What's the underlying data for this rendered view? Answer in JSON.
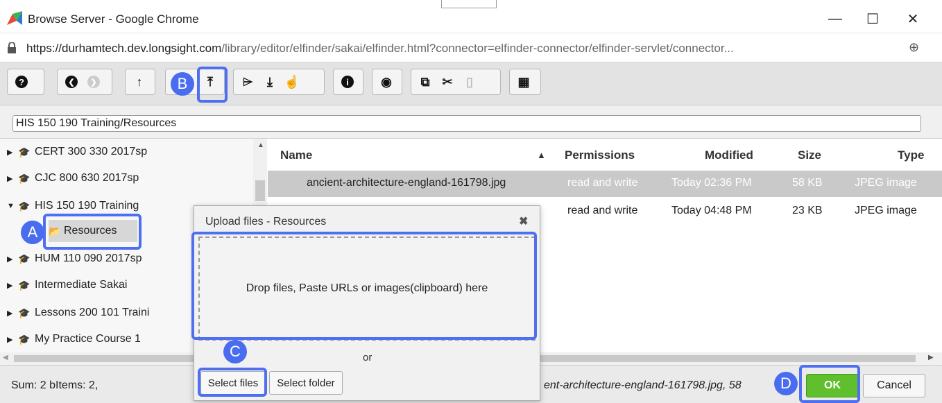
{
  "window": {
    "title": "Browse Server - Google Chrome",
    "minimize_glyph": "—",
    "maximize_glyph": "☐",
    "close_glyph": "✕"
  },
  "address": {
    "url_host": "https://durhamtech.dev.longsight.com",
    "url_path": "/library/editor/elfinder/sakai/elfinder.html?connector=elfinder-connector/elfinder-servlet/connector...",
    "zoom_glyph": "⊕"
  },
  "toolbar": {
    "groups": [
      {
        "buttons": [
          {
            "icon": "help-icon",
            "glyph": "?"
          }
        ]
      },
      {
        "buttons": [
          {
            "icon": "back-icon",
            "glyph": "❮"
          },
          {
            "icon": "forward-icon",
            "glyph": "❯",
            "disabled": true
          }
        ]
      },
      {
        "buttons": [
          {
            "icon": "up-icon",
            "glyph": "↑"
          }
        ]
      },
      {
        "buttons": [
          {
            "icon": "upload-icon",
            "glyph": "⤒"
          }
        ]
      },
      {
        "buttons": [
          {
            "icon": "open-folder-icon",
            "glyph": "⌲"
          },
          {
            "icon": "download-icon",
            "glyph": "⤓"
          },
          {
            "icon": "select-icon",
            "glyph": "☝"
          }
        ]
      },
      {
        "buttons": [
          {
            "icon": "info-icon",
            "glyph": "i"
          }
        ]
      },
      {
        "buttons": [
          {
            "icon": "preview-icon",
            "glyph": "◉"
          }
        ]
      },
      {
        "buttons": [
          {
            "icon": "copy-icon",
            "glyph": "⧉"
          },
          {
            "icon": "cut-icon",
            "glyph": "✂"
          },
          {
            "icon": "paste-icon",
            "glyph": "▯",
            "disabled": true
          }
        ]
      },
      {
        "buttons": [
          {
            "icon": "grid-view-icon",
            "glyph": "▦"
          }
        ]
      }
    ]
  },
  "path": {
    "value": "HIS 150 190 Training/Resources"
  },
  "tree": {
    "items": [
      {
        "label": "CERT 300 330 2017sp",
        "arrow": "▶"
      },
      {
        "label": "CJC 800 630 2017sp",
        "arrow": "▶"
      },
      {
        "label": "HIS 150 190 Training",
        "arrow": "▼"
      },
      {
        "label": "Resources",
        "active": true
      },
      {
        "label": "HUM 110 090 2017sp",
        "arrow": "▶"
      },
      {
        "label": "Intermediate Sakai",
        "arrow": "▶"
      },
      {
        "label": "Lessons 200 101 Traini",
        "arrow": "▶"
      },
      {
        "label": "My Practice Course 1",
        "arrow": "▶"
      }
    ]
  },
  "files": {
    "headers": {
      "name": "Name",
      "sort": "▲",
      "permissions": "Permissions",
      "modified": "Modified",
      "size": "Size",
      "type": "Type"
    },
    "rows": [
      {
        "name": "ancient-architecture-england-161798.jpg",
        "permissions": "read and write",
        "modified": "Today 02:36 PM",
        "size": "58 KB",
        "type": "JPEG image"
      },
      {
        "name": "",
        "permissions": "read and write",
        "modified": "Today 04:48 PM",
        "size": "23 KB",
        "type": "JPEG image"
      }
    ]
  },
  "status": {
    "left": "Sum: 2 bItems: 2,",
    "right": "ent-architecture-england-161798.jpg, 58",
    "ok_label": "OK",
    "cancel_label": "Cancel"
  },
  "dialog": {
    "title": "Upload files - Resources",
    "close_glyph": "✖",
    "dropzone_text": "Drop files, Paste URLs or images(clipboard) here",
    "or_text": "or",
    "select_files_label": "Select files",
    "select_folder_label": "Select folder"
  },
  "markers": {
    "a": "A",
    "b": "B",
    "c": "C",
    "d": "D"
  },
  "colors": {
    "highlight": "#4d6ff0",
    "ok_green": "#5fbf2d",
    "selected_row": "#c9c9c9"
  }
}
